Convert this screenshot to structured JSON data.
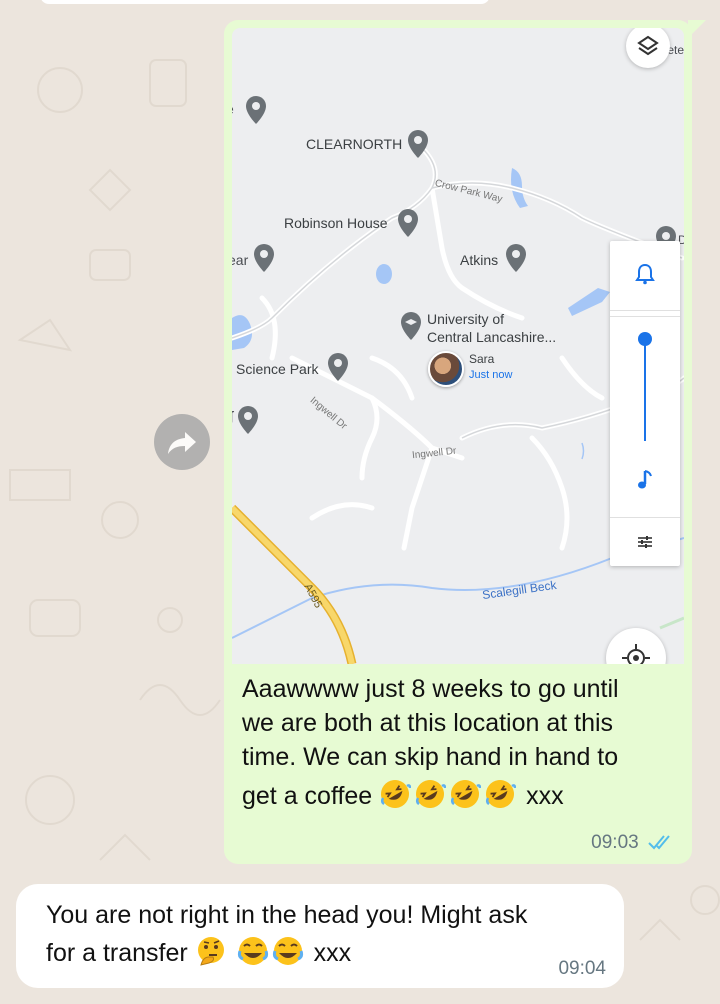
{
  "map": {
    "places": {
      "clearnorth": "CLEARNORTH",
      "robinson": "Robinson House",
      "atkins": "Atkins",
      "uclan_line1": "University of",
      "uclan_line2": "Central Lancashire...",
      "science_park": "Science Park",
      "left_partial_1": "e",
      "left_partial_2": "ear",
      "left_partial_3": "ʃ",
      "top_right_partial": "Vete",
      "right_partial": "D"
    },
    "roads": {
      "crow_park": "Crow Park Way",
      "ingwell_1": "Ingwell Dr",
      "ingwell_2": "Ingwell Dr",
      "a595": "A595"
    },
    "water": {
      "scalegill": "Scalegill Beck"
    },
    "location": {
      "name": "Sara",
      "updated": "Just now"
    },
    "icons": [
      "layers-icon",
      "bell-icon",
      "music-note-icon",
      "sliders-icon",
      "my-location-icon",
      "place-pin-icon"
    ],
    "colors": {
      "pin": "#6b7176",
      "water": "#a5c6f6",
      "road_major": "#f6c845",
      "accent": "#1a73e8"
    }
  },
  "messages": {
    "outgoing": {
      "text_line1": "Aaawwww just 8 weeks to go until",
      "text_line2": "we are both at this location at this",
      "text_line3": "time. We can skip hand in hand to",
      "text_line4_prefix": "get a coffee",
      "text_line4_suffix": "xxx",
      "emoji": "rolling-on-floor-laughing x4",
      "time": "09:03",
      "status": "read"
    },
    "incoming": {
      "text_line1": "You are not right in the head you! Might ask",
      "text_line2_prefix": "for a transfer",
      "text_line2_suffix": "xxx",
      "emoji": "thinking-face, face-with-tears-of-joy x2",
      "time": "09:04"
    }
  },
  "colors": {
    "chat_background": "#ece5dd",
    "outgoing_bubble": "#e7fbd3",
    "incoming_bubble": "#ffffff",
    "read_ticks": "#53bdeb"
  }
}
